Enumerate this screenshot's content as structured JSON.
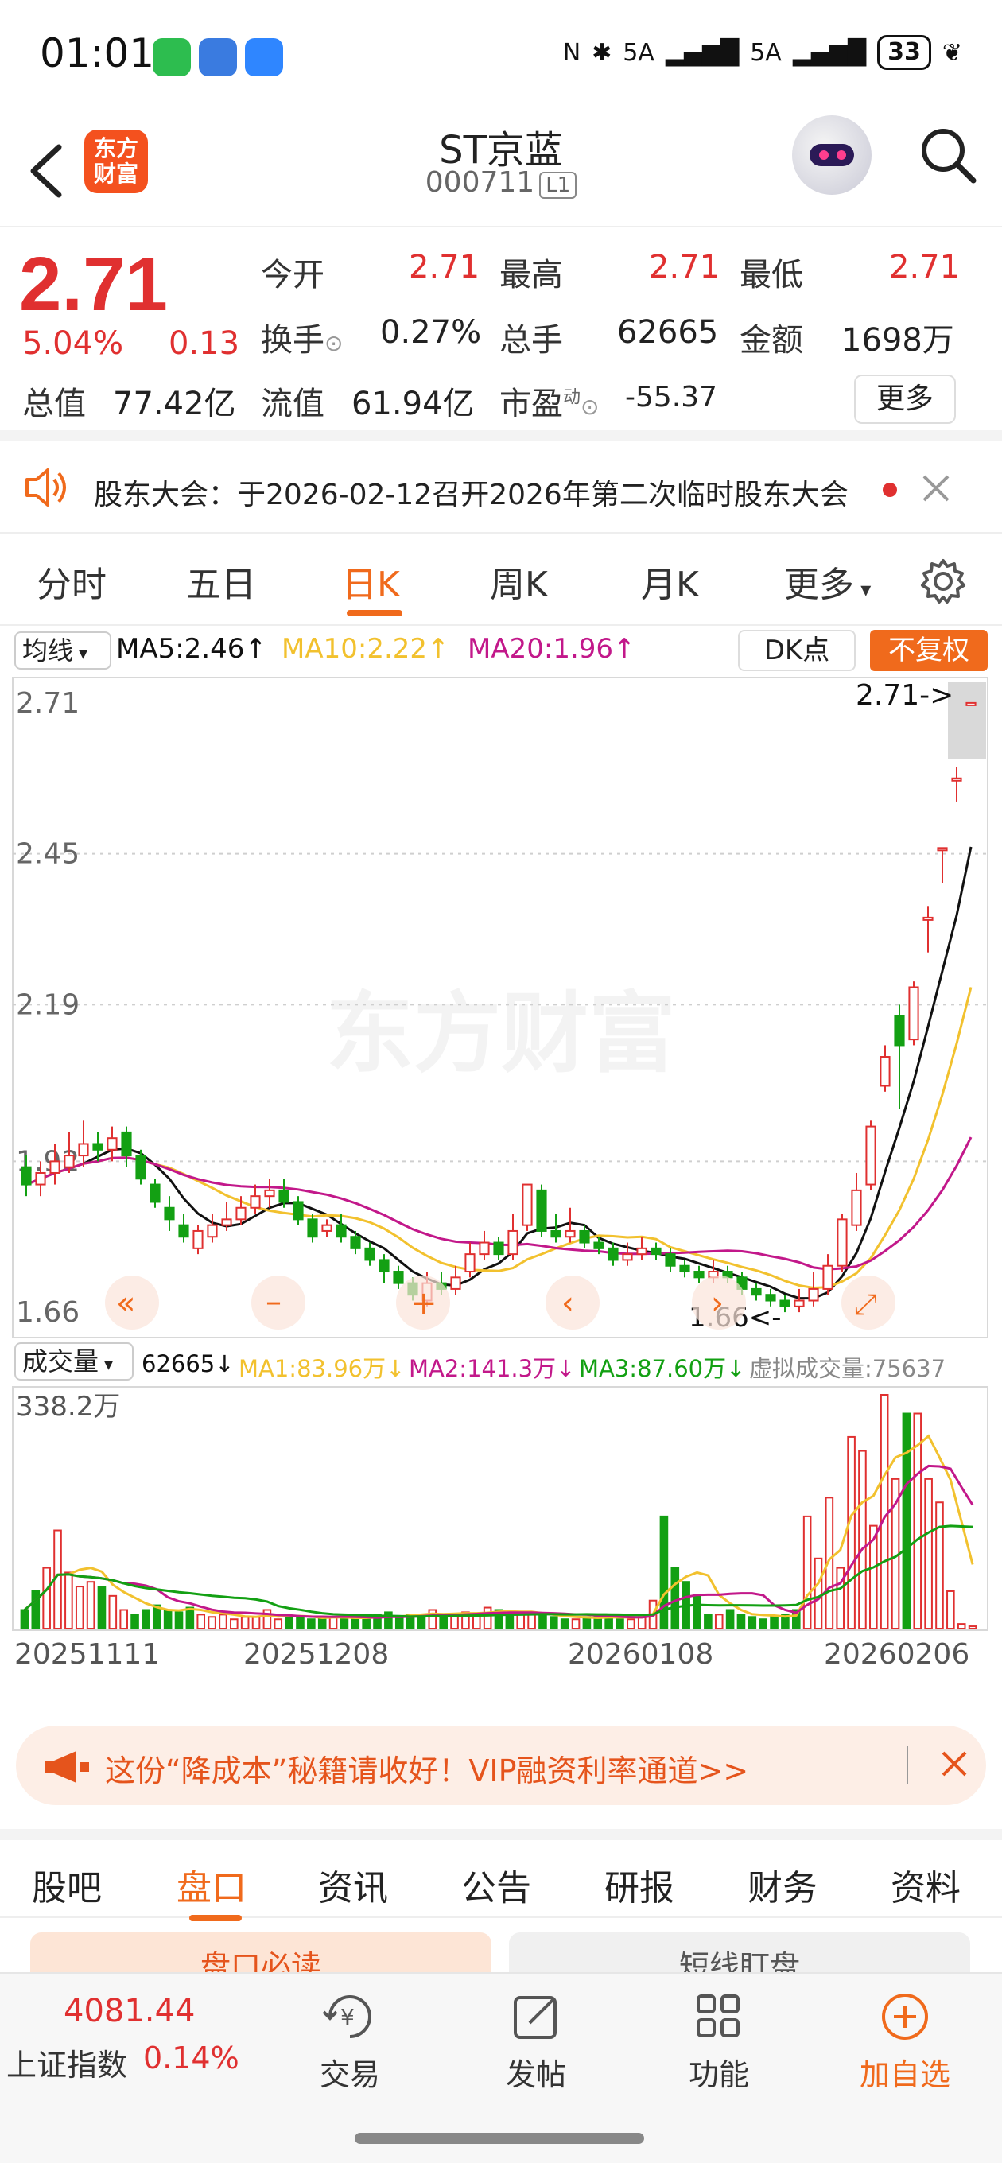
{
  "status_bar": {
    "time": "01:01",
    "signal1": "5A",
    "signal2": "5A",
    "battery": "33"
  },
  "header": {
    "brand_logo": "东方\n财富",
    "stock_name": "ST京蓝",
    "stock_code": "000711",
    "level": "L1"
  },
  "quote": {
    "price": "2.71",
    "change_pct": "5.04%",
    "change_amt": "0.13",
    "open_label": "今开",
    "open": "2.71",
    "high_label": "最高",
    "high": "2.71",
    "low_label": "最低",
    "low": "2.71",
    "turnover_label": "换手",
    "turnover": "0.27%",
    "volume_label": "总手",
    "volume": "62665",
    "amount_label": "金额",
    "amount": "1698万",
    "mktcap_label": "总值",
    "mktcap": "77.42亿",
    "float_label": "流值",
    "float": "61.94亿",
    "pe_label": "市盈",
    "pe_sup": "动",
    "pe": "-55.37",
    "more": "更多"
  },
  "notice": {
    "text": "股东大会：于2026-02-12召开2026年第二次临时股东大会"
  },
  "period_tabs": [
    "分时",
    "五日",
    "日K",
    "周K",
    "月K",
    "更多"
  ],
  "ma_legend": {
    "select": "均线",
    "ma5": "MA5:2.46↑",
    "ma10": "MA10:2.22↑",
    "ma20": "MA20:1.96↑",
    "dk": "DK点",
    "adjust": "不复权"
  },
  "chart_data": {
    "type": "candlestick",
    "y_ticks": [
      "2.71",
      "2.45",
      "2.19",
      "1.92",
      "1.66"
    ],
    "ylim": [
      1.63,
      2.74
    ],
    "last_marker": "2.71->",
    "low_marker": "1.66<-",
    "watermark": "东方财富",
    "candles": [
      [
        1.91,
        1.88,
        1.93,
        1.86
      ],
      [
        1.88,
        1.9,
        1.92,
        1.86
      ],
      [
        1.9,
        1.92,
        1.95,
        1.88
      ],
      [
        1.91,
        1.93,
        1.97,
        1.9
      ],
      [
        1.93,
        1.95,
        1.99,
        1.91
      ],
      [
        1.95,
        1.94,
        1.97,
        1.92
      ],
      [
        1.94,
        1.96,
        1.98,
        1.92
      ],
      [
        1.97,
        1.93,
        1.98,
        1.91
      ],
      [
        1.93,
        1.89,
        1.94,
        1.88
      ],
      [
        1.88,
        1.85,
        1.89,
        1.84
      ],
      [
        1.84,
        1.82,
        1.86,
        1.8
      ],
      [
        1.81,
        1.79,
        1.83,
        1.78
      ],
      [
        1.77,
        1.8,
        1.81,
        1.76
      ],
      [
        1.79,
        1.81,
        1.83,
        1.78
      ],
      [
        1.81,
        1.82,
        1.85,
        1.8
      ],
      [
        1.82,
        1.84,
        1.86,
        1.81
      ],
      [
        1.84,
        1.86,
        1.88,
        1.83
      ],
      [
        1.86,
        1.87,
        1.89,
        1.84
      ],
      [
        1.87,
        1.85,
        1.89,
        1.84
      ],
      [
        1.85,
        1.82,
        1.86,
        1.81
      ],
      [
        1.82,
        1.79,
        1.83,
        1.78
      ],
      [
        1.8,
        1.81,
        1.82,
        1.79
      ],
      [
        1.81,
        1.79,
        1.83,
        1.78
      ],
      [
        1.79,
        1.77,
        1.8,
        1.76
      ],
      [
        1.77,
        1.75,
        1.78,
        1.74
      ],
      [
        1.75,
        1.73,
        1.76,
        1.71
      ],
      [
        1.73,
        1.71,
        1.74,
        1.7
      ],
      [
        1.71,
        1.69,
        1.72,
        1.68
      ],
      [
        1.68,
        1.71,
        1.73,
        1.67
      ],
      [
        1.71,
        1.7,
        1.73,
        1.69
      ],
      [
        1.7,
        1.72,
        1.74,
        1.69
      ],
      [
        1.73,
        1.76,
        1.78,
        1.72
      ],
      [
        1.76,
        1.78,
        1.8,
        1.75
      ],
      [
        1.78,
        1.76,
        1.79,
        1.75
      ],
      [
        1.76,
        1.8,
        1.83,
        1.75
      ],
      [
        1.81,
        1.88,
        1.88,
        1.8
      ],
      [
        1.87,
        1.8,
        1.88,
        1.79
      ],
      [
        1.8,
        1.79,
        1.83,
        1.78
      ],
      [
        1.79,
        1.8,
        1.84,
        1.78
      ],
      [
        1.8,
        1.78,
        1.81,
        1.77
      ],
      [
        1.78,
        1.77,
        1.79,
        1.76
      ],
      [
        1.77,
        1.75,
        1.78,
        1.74
      ],
      [
        1.75,
        1.76,
        1.78,
        1.74
      ],
      [
        1.76,
        1.77,
        1.79,
        1.75
      ],
      [
        1.77,
        1.76,
        1.78,
        1.75
      ],
      [
        1.76,
        1.74,
        1.77,
        1.73
      ],
      [
        1.74,
        1.73,
        1.75,
        1.72
      ],
      [
        1.73,
        1.72,
        1.74,
        1.71
      ],
      [
        1.72,
        1.73,
        1.75,
        1.71
      ],
      [
        1.73,
        1.72,
        1.74,
        1.71
      ],
      [
        1.72,
        1.7,
        1.73,
        1.69
      ],
      [
        1.7,
        1.69,
        1.71,
        1.68
      ],
      [
        1.69,
        1.68,
        1.7,
        1.67
      ],
      [
        1.68,
        1.67,
        1.69,
        1.66
      ],
      [
        1.67,
        1.68,
        1.7,
        1.66
      ],
      [
        1.68,
        1.7,
        1.73,
        1.67
      ],
      [
        1.7,
        1.74,
        1.76,
        1.69
      ],
      [
        1.74,
        1.82,
        1.83,
        1.73
      ],
      [
        1.81,
        1.87,
        1.9,
        1.8
      ],
      [
        1.88,
        1.98,
        1.99,
        1.87
      ],
      [
        2.05,
        2.1,
        2.12,
        2.04
      ],
      [
        2.17,
        2.12,
        2.19,
        2.01
      ],
      [
        2.13,
        2.22,
        2.23,
        2.12
      ],
      [
        2.34,
        2.34,
        2.36,
        2.28
      ],
      [
        2.46,
        2.46,
        2.46,
        2.4
      ],
      [
        2.58,
        2.58,
        2.6,
        2.54
      ],
      [
        2.71,
        2.71,
        2.71,
        2.71
      ]
    ]
  },
  "volume_legend": {
    "select": "成交量",
    "vol": "62665↓",
    "ma1": "MA1:83.96万↓",
    "ma2": "MA2:141.3万↓",
    "ma3": "MA3:87.60万↓",
    "virtual": "虚拟成交量:75637",
    "max_label": "338.2万",
    "volumes": [
      40,
      80,
      130,
      210,
      120,
      90,
      100,
      90,
      70,
      40,
      30,
      40,
      50,
      40,
      35,
      45,
      30,
      25,
      30,
      20,
      25,
      25,
      40,
      20,
      25,
      25,
      20,
      25,
      25,
      25,
      20,
      20,
      30,
      35,
      25,
      30,
      30,
      40,
      30,
      30,
      35,
      30,
      45,
      40,
      35,
      30,
      30,
      30,
      25,
      20,
      20,
      25,
      25,
      30,
      20,
      20,
      25,
      60,
      240,
      130,
      100,
      70,
      30,
      30,
      40,
      30,
      25,
      20,
      25,
      30,
      40,
      240,
      150,
      280,
      130,
      410,
      380,
      220,
      500,
      320,
      460,
      460,
      320,
      270,
      80,
      10,
      5
    ]
  },
  "dates": [
    "20251111",
    "20251208",
    "20260108",
    "20260206"
  ],
  "promo": {
    "text": "这份“降成本”秘籍请收好！VIP融资利率通道>>"
  },
  "bottom_tabs": [
    "股吧",
    "盘口",
    "资讯",
    "公告",
    "研报",
    "财务",
    "资料"
  ],
  "sub_cards": [
    "盘口必读",
    "短线盯盘"
  ],
  "bottom_nav": {
    "index_value": "4081.44",
    "index_name": "上证指数",
    "index_pct": "0.14%",
    "trade": "交易",
    "post": "发帖",
    "func": "功能",
    "add": "加自选"
  },
  "colors": {
    "up": "#e03030",
    "down": "#13a013",
    "accent": "#f06a1c",
    "ma5": "#111111",
    "ma10": "#f2c12e",
    "ma20": "#c2188a"
  }
}
